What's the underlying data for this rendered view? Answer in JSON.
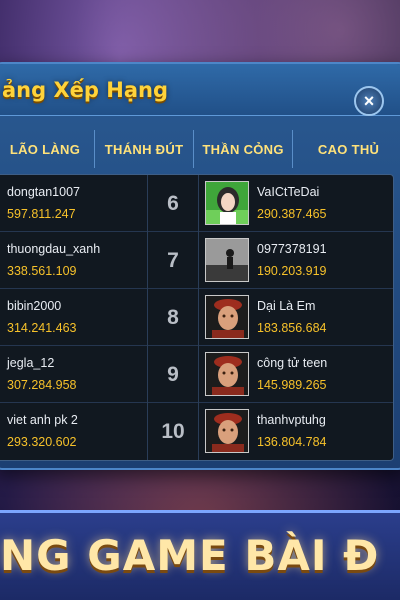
{
  "panel": {
    "title": "ảng Xếp Hạng"
  },
  "close_icon": "×",
  "tabs": [
    "LÃO LÀNG",
    "THÁNH ĐÚT",
    "THẦN CỎNG",
    "CAO THỦ"
  ],
  "left_entries": [
    {
      "name": "dongtan1007",
      "score": "597.811.247"
    },
    {
      "name": "thuongdau_xanh",
      "score": "338.561.109"
    },
    {
      "name": "bibin2000",
      "score": "314.241.463"
    },
    {
      "name": "jegla_12",
      "score": "307.284.958"
    },
    {
      "name": "viet anh pk 2",
      "score": "293.320.602"
    }
  ],
  "right_entries": [
    {
      "rank": "6",
      "name": "VaICtTeDai",
      "score": "290.387.465",
      "avatar": "girl-photo-avatar"
    },
    {
      "rank": "7",
      "name": "0977378191",
      "score": "190.203.919",
      "avatar": "silhouette-photo-avatar"
    },
    {
      "rank": "8",
      "name": "Dại Là Em",
      "score": "183.856.684",
      "avatar": "mandarin-avatar"
    },
    {
      "rank": "9",
      "name": "công tử teen",
      "score": "145.989.265",
      "avatar": "mandarin-avatar"
    },
    {
      "rank": "10",
      "name": "thanhvptuhg",
      "score": "136.804.784",
      "avatar": "mandarin-avatar"
    }
  ],
  "banner": {
    "text": "NG GAME BÀI Đ"
  }
}
